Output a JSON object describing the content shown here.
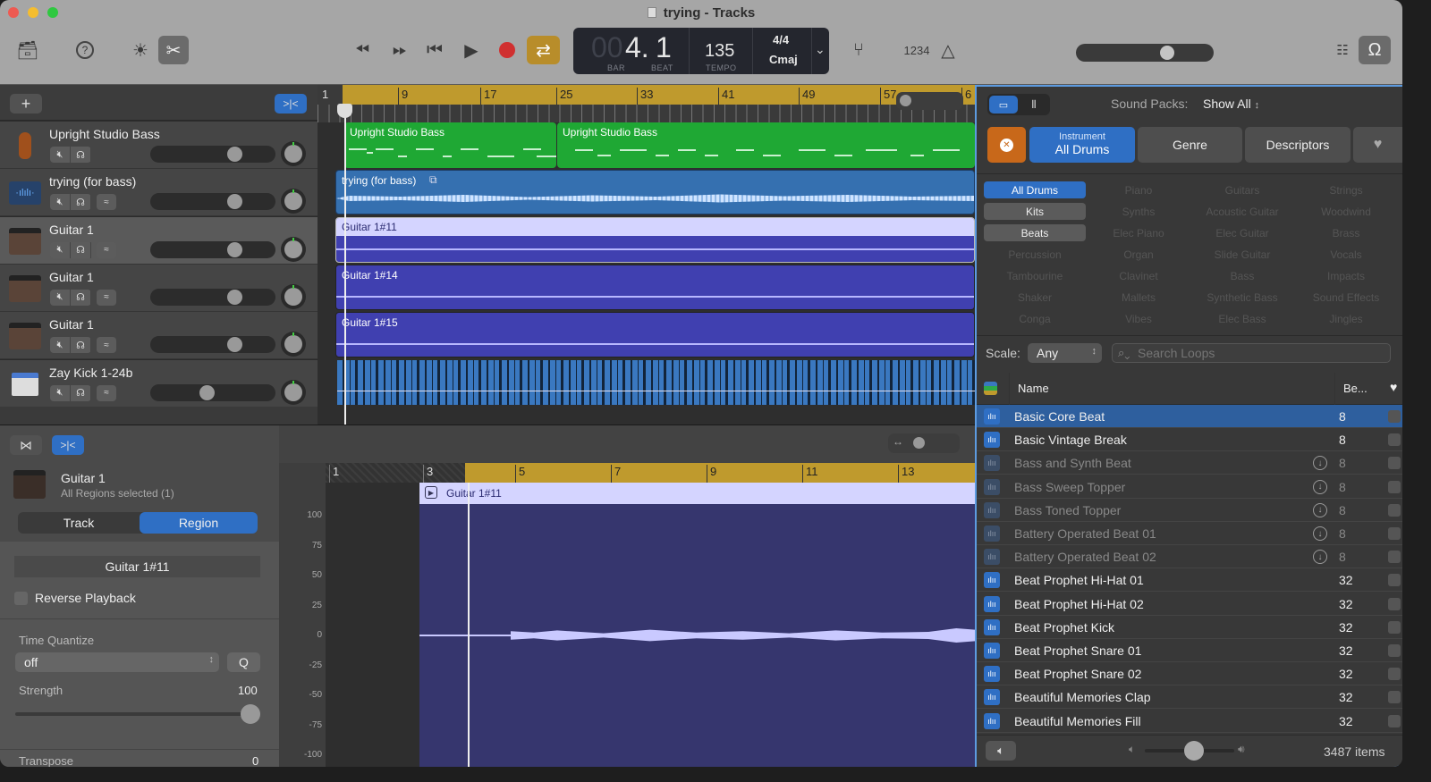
{
  "window": {
    "title": "trying - Tracks"
  },
  "toolbar": {
    "library_icon": "inbox-icon",
    "help_icon": "help-icon",
    "smart_controls_icon": "smart-controls-icon",
    "editors_icon": "scissors-icon",
    "transport": [
      "rewind-icon",
      "fast-forward-icon",
      "go-to-start-icon",
      "play-icon",
      "record-icon",
      "cycle-icon"
    ],
    "lcd": {
      "bar_dim": "00",
      "bar": "4.",
      "beat": "1",
      "bar_label": "BAR",
      "beat_label": "BEAT",
      "tempo": "135",
      "tempo_label": "TEMPO",
      "signature": "4/4",
      "key": "Cmaj"
    },
    "tuner_icon": "tuner-icon",
    "count_in": "1234",
    "metronome_icon": "metronome-icon",
    "master_volume": 0.68,
    "notepad_icon": "notepad-icon",
    "loops_icon": "loop-browser-icon"
  },
  "tracks": [
    {
      "name": "Upright Studio Bass",
      "icon": "upright-bass-icon",
      "volume": 0.72,
      "has_record": false,
      "selected": false
    },
    {
      "name": "trying (for bass)",
      "icon": "audio-waveform-icon",
      "volume": 0.72,
      "has_record": true,
      "selected": false
    },
    {
      "name": "Guitar 1",
      "icon": "guitar-amp-icon",
      "volume": 0.72,
      "has_record": true,
      "selected": true
    },
    {
      "name": "Guitar 1",
      "icon": "guitar-amp-icon",
      "volume": 0.72,
      "has_record": true,
      "selected": false
    },
    {
      "name": "Guitar 1",
      "icon": "guitar-amp-icon",
      "volume": 0.72,
      "has_record": true,
      "selected": false
    },
    {
      "name": "Zay Kick 1-24b",
      "icon": "drum-machine-icon",
      "volume": 0.46,
      "has_record": true,
      "selected": false
    }
  ],
  "ruler": {
    "marks": [
      "1",
      "9",
      "17",
      "25",
      "33",
      "41",
      "49",
      "57",
      "6"
    ]
  },
  "regions": {
    "bass1": "Upright Studio Bass",
    "bass2": "Upright Studio Bass",
    "audio": "trying (for bass)",
    "g11": "Guitar 1#11",
    "g14": "Guitar 1#14",
    "g15": "Guitar 1#15"
  },
  "editor": {
    "track_name": "Guitar 1",
    "subtitle": "All Regions selected (1)",
    "tabs": [
      "Track",
      "Region"
    ],
    "active_tab": "Region",
    "region_name": "Guitar 1#11",
    "reverse_playback": "Reverse Playback",
    "time_quantize_label": "Time Quantize",
    "time_quantize_value": "off",
    "q_button": "Q",
    "strength_label": "Strength",
    "strength_value": "100",
    "transpose_label": "Transpose",
    "transpose_value": "0",
    "ruler": [
      "1",
      "3",
      "5",
      "7",
      "9",
      "11",
      "13"
    ],
    "region_label": "Guitar 1#11",
    "axis": [
      "100",
      "75",
      "50",
      "25",
      "0",
      "-25",
      "-50",
      "-75",
      "-100"
    ]
  },
  "loops": {
    "sound_packs_label": "Sound Packs:",
    "sound_packs_value": "Show All",
    "filter_tabs": {
      "instrument_top": "Instrument",
      "instrument_value": "All Drums",
      "genre": "Genre",
      "descriptors": "Descriptors"
    },
    "categories": [
      [
        "All Drums",
        "Piano",
        "Guitars",
        "Strings"
      ],
      [
        "Kits",
        "Synths",
        "Acoustic Guitar",
        "Woodwind"
      ],
      [
        "Beats",
        "Elec Piano",
        "Elec Guitar",
        "Brass"
      ],
      [
        "Percussion",
        "Organ",
        "Slide Guitar",
        "Vocals"
      ],
      [
        "Tambourine",
        "Clavinet",
        "Bass",
        "Impacts"
      ],
      [
        "Shaker",
        "Mallets",
        "Synthetic Bass",
        "Sound Effects"
      ],
      [
        "Conga",
        "Vibes",
        "Elec Bass",
        "Jingles"
      ]
    ],
    "scale_label": "Scale:",
    "scale_value": "Any",
    "search_placeholder": "Search Loops",
    "columns": {
      "name": "Name",
      "beats": "Be..."
    },
    "rows": [
      {
        "name": "Basic Core Beat",
        "beats": "8",
        "download": false,
        "selected": true
      },
      {
        "name": "Basic Vintage Break",
        "beats": "8",
        "download": false,
        "selected": false
      },
      {
        "name": "Bass and Synth Beat",
        "beats": "8",
        "download": true,
        "selected": false
      },
      {
        "name": "Bass Sweep Topper",
        "beats": "8",
        "download": true,
        "selected": false
      },
      {
        "name": "Bass Toned Topper",
        "beats": "8",
        "download": true,
        "selected": false
      },
      {
        "name": "Battery Operated Beat 01",
        "beats": "8",
        "download": true,
        "selected": false
      },
      {
        "name": "Battery Operated Beat 02",
        "beats": "8",
        "download": true,
        "selected": false
      },
      {
        "name": "Beat Prophet Hi-Hat 01",
        "beats": "32",
        "download": false,
        "selected": false
      },
      {
        "name": "Beat Prophet Hi-Hat 02",
        "beats": "32",
        "download": false,
        "selected": false
      },
      {
        "name": "Beat Prophet Kick",
        "beats": "32",
        "download": false,
        "selected": false
      },
      {
        "name": "Beat Prophet Snare 01",
        "beats": "32",
        "download": false,
        "selected": false
      },
      {
        "name": "Beat Prophet Snare 02",
        "beats": "32",
        "download": false,
        "selected": false
      },
      {
        "name": "Beautiful Memories Clap",
        "beats": "32",
        "download": false,
        "selected": false
      },
      {
        "name": "Beautiful Memories Fill",
        "beats": "32",
        "download": false,
        "selected": false
      }
    ],
    "preview_volume": 0.55,
    "item_count": "3487 items"
  },
  "colors": {
    "accent": "#2f6fc4",
    "cycle": "#b88d2a",
    "record": "#d03030",
    "midi_region": "#1fa834",
    "audio_region": "#3570b0",
    "guitar_region": "#4040b0"
  }
}
